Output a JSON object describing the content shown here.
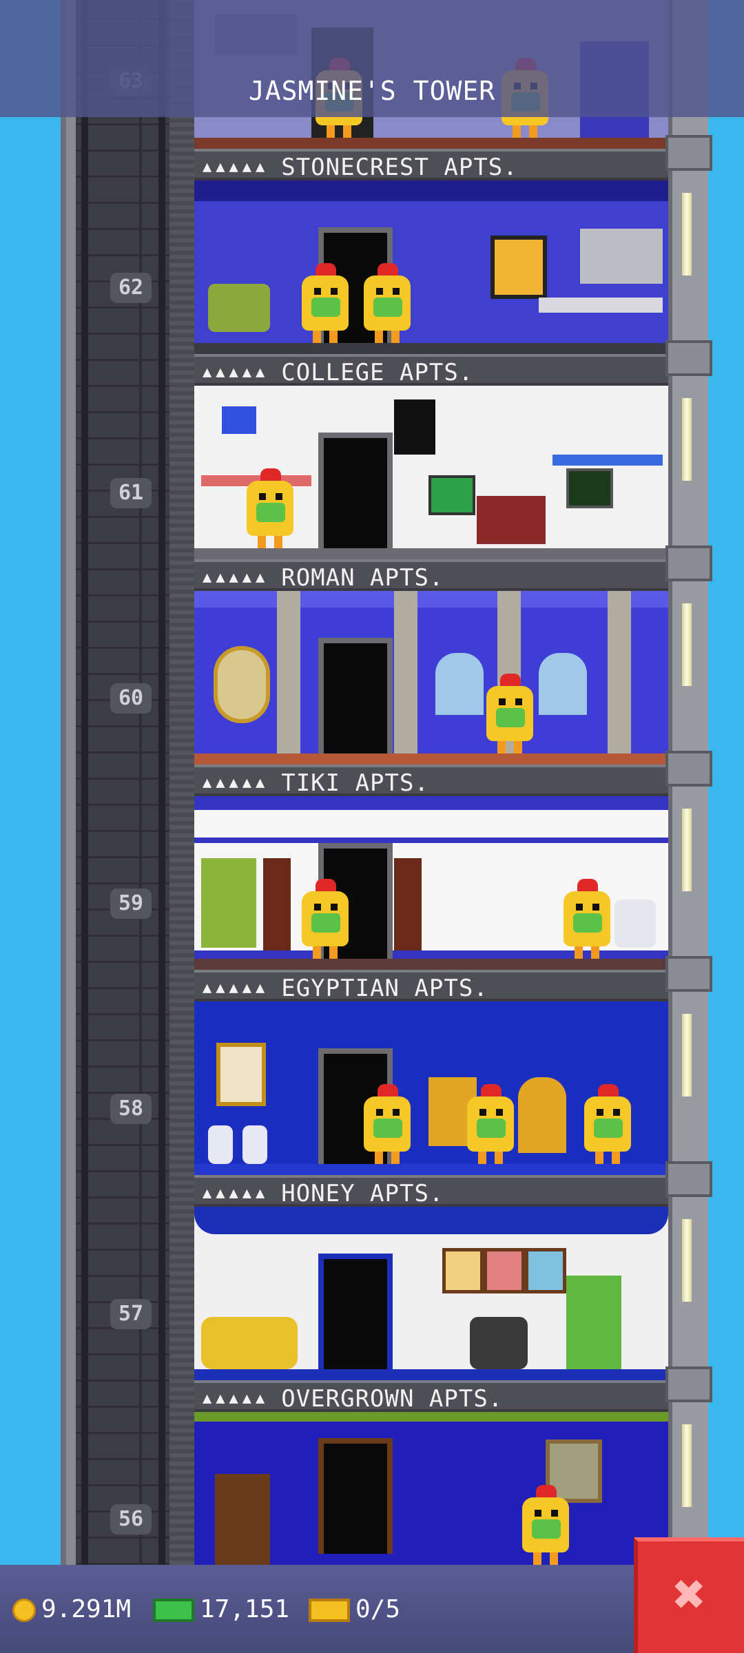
{
  "header": {
    "tower_name": "JASMINE'S TOWER"
  },
  "floors": [
    {
      "number": "63",
      "name": "",
      "stars": ""
    },
    {
      "number": "62",
      "name": "STONECREST APTS.",
      "stars": "▲▲▲▲▲",
      "wall_color": "#3f3fd0",
      "trim_color": "#1e1e8e"
    },
    {
      "number": "61",
      "name": "COLLEGE APTS.",
      "stars": "▲▲▲▲▲",
      "wall_color": "#f2f2f2",
      "trim_color": "#d8d8d8"
    },
    {
      "number": "60",
      "name": "ROMAN APTS.",
      "stars": "▲▲▲▲▲",
      "wall_color": "#3e3ed6",
      "trim_color": "#5a5ae8"
    },
    {
      "number": "59",
      "name": "TIKI APTS.",
      "stars": "▲▲▲▲▲",
      "wall_color": "#f6f6f6",
      "trim_color": "#3434c4"
    },
    {
      "number": "58",
      "name": "EGYPTIAN APTS.",
      "stars": "▲▲▲▲▲",
      "wall_color": "#1a2ec0",
      "trim_color": "#2438d0"
    },
    {
      "number": "57",
      "name": "HONEY APTS.",
      "stars": "▲▲▲▲▲",
      "wall_color": "#f0f0f0",
      "trim_color": "#1d2fb8"
    },
    {
      "number": "56",
      "name": "OVERGROWN APTS.",
      "stars": "▲▲▲▲▲",
      "wall_color": "#2020b8",
      "trim_color": "#6a9a2a"
    }
  ],
  "status": {
    "coins": "9.291M",
    "bux": "17,151",
    "tickets": "0/5"
  },
  "icons": {
    "coin": "coin-icon",
    "bux": "cash-icon",
    "ticket": "ticket-icon",
    "close": "close-icon"
  }
}
